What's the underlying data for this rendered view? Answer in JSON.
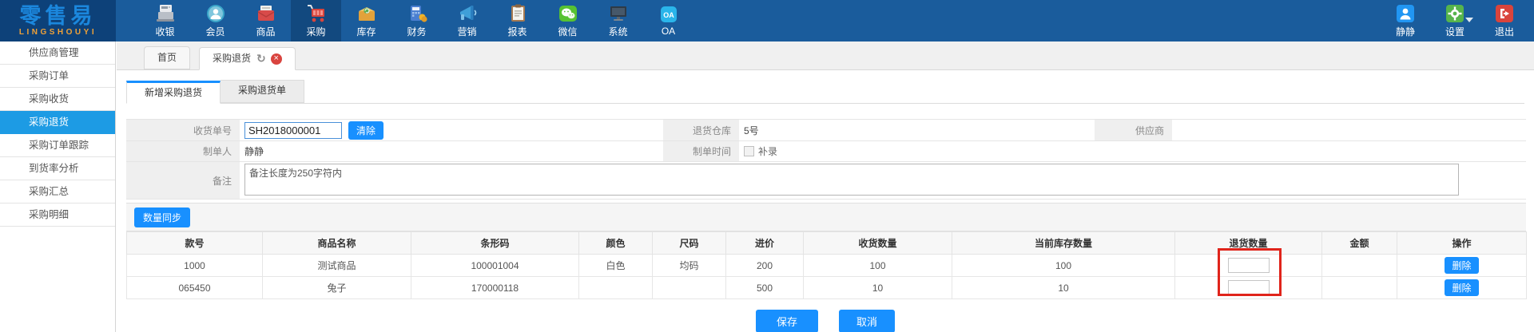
{
  "topbar": {
    "logo": {
      "title": "零售易",
      "subtitle": "LINGSHOUYI"
    },
    "nav": [
      {
        "label": "收银",
        "icon": "cash-register-icon",
        "active": false
      },
      {
        "label": "会员",
        "icon": "member-icon",
        "active": false
      },
      {
        "label": "商品",
        "icon": "product-icon",
        "active": false
      },
      {
        "label": "采购",
        "icon": "purchase-cart-icon",
        "active": true
      },
      {
        "label": "库存",
        "icon": "inventory-icon",
        "active": false
      },
      {
        "label": "财务",
        "icon": "finance-icon",
        "active": false
      },
      {
        "label": "营销",
        "icon": "marketing-icon",
        "active": false
      },
      {
        "label": "报表",
        "icon": "report-icon",
        "active": false
      },
      {
        "label": "微信",
        "icon": "wechat-icon",
        "active": false
      },
      {
        "label": "系统",
        "icon": "system-icon",
        "active": false
      },
      {
        "label": "OA",
        "icon": "oa-icon",
        "active": false
      }
    ],
    "user": {
      "label": "静静"
    },
    "settings": {
      "label": "设置"
    },
    "logout": {
      "label": "退出"
    }
  },
  "sidebar": {
    "items": [
      {
        "label": "供应商管理",
        "active": false
      },
      {
        "label": "采购订单",
        "active": false
      },
      {
        "label": "采购收货",
        "active": false
      },
      {
        "label": "采购退货",
        "active": true
      },
      {
        "label": "采购订单跟踪",
        "active": false
      },
      {
        "label": "到货率分析",
        "active": false
      },
      {
        "label": "采购汇总",
        "active": false
      },
      {
        "label": "采购明细",
        "active": false
      }
    ]
  },
  "tabs": {
    "items": [
      {
        "label": "首页",
        "active": false
      },
      {
        "label": "采购退货",
        "active": true,
        "refresh_icon": "refresh-icon",
        "close_icon": "close-icon"
      }
    ]
  },
  "subtabs": {
    "items": [
      {
        "label": "新增采购退货",
        "active": true
      },
      {
        "label": "采购退货单",
        "active": false
      }
    ]
  },
  "form": {
    "receipt_no": {
      "label": "收货单号",
      "value": "SH2018000001",
      "clear_label": "清除"
    },
    "warehouse": {
      "label": "退货仓库",
      "value": "5号"
    },
    "supplier": {
      "label": "供应商",
      "value": ""
    },
    "maker": {
      "label": "制单人",
      "value": "静静"
    },
    "make_time": {
      "label": "制单时间",
      "checkbox_label": "补录",
      "checked": false
    },
    "remark": {
      "label": "备注",
      "value": "备注长度为250字符内"
    }
  },
  "toolbar": {
    "sync_label": "数量同步"
  },
  "table": {
    "columns": [
      "款号",
      "商品名称",
      "条形码",
      "颜色",
      "尺码",
      "进价",
      "收货数量",
      "当前库存数量",
      "退货数量",
      "金额",
      "操作"
    ],
    "rows": [
      {
        "style_no": "1000",
        "name": "测试商品",
        "barcode": "100001004",
        "color": "白色",
        "size": "均码",
        "price": "200",
        "received": "100",
        "stock": "100",
        "return_qty": "",
        "amount": "",
        "action": "删除"
      },
      {
        "style_no": "065450",
        "name": "兔子",
        "barcode": "170000118",
        "color": "",
        "size": "",
        "price": "500",
        "received": "10",
        "stock": "10",
        "return_qty": "",
        "amount": "",
        "action": "删除"
      }
    ]
  },
  "footer": {
    "save_label": "保存",
    "cancel_label": "取消"
  },
  "colors": {
    "accent": "#1890ff",
    "topbar": "#1a5c9c",
    "logo_bg": "#0d4179",
    "sidebar_active": "#1d9be4",
    "highlight_box": "#e0241b",
    "logo_text": "#1b87dd",
    "logo_sub": "#efa138"
  }
}
